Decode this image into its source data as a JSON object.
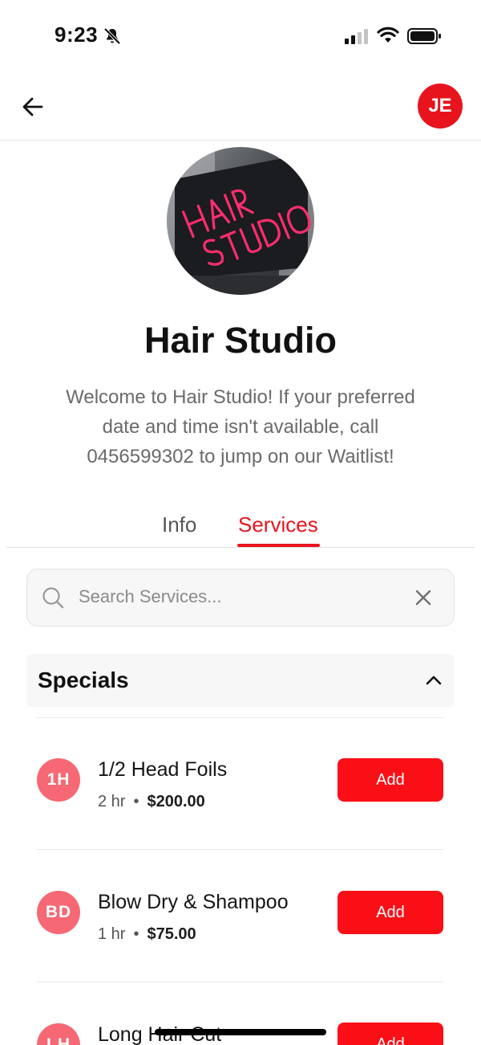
{
  "status_bar": {
    "time": "9:23"
  },
  "header": {
    "avatar_initials": "JE"
  },
  "profile": {
    "name": "Hair Studio",
    "description": "Welcome to Hair Studio! If your preferred date and time isn't available, call 0456599302 to jump on our Waitlist!",
    "photo_sign_text": "HAIR STUDIO"
  },
  "tabs": [
    {
      "label": "Info",
      "active": false
    },
    {
      "label": "Services",
      "active": true
    }
  ],
  "search": {
    "placeholder": "Search Services...",
    "value": ""
  },
  "section": {
    "title": "Specials",
    "expanded": true
  },
  "services": [
    {
      "initials": "1H",
      "name": "1/2 Head Foils",
      "duration": "2 hr",
      "price": "$200.00",
      "button": "Add"
    },
    {
      "initials": "BD",
      "name": "Blow Dry & Shampoo",
      "duration": "1 hr",
      "price": "$75.00",
      "button": "Add"
    },
    {
      "initials": "LH",
      "name": "Long Hair Cut",
      "duration": "",
      "price": "",
      "button": "Add"
    }
  ],
  "colors": {
    "accent": "#e8141d",
    "button": "#fb0f17",
    "badge": "#f56874"
  }
}
